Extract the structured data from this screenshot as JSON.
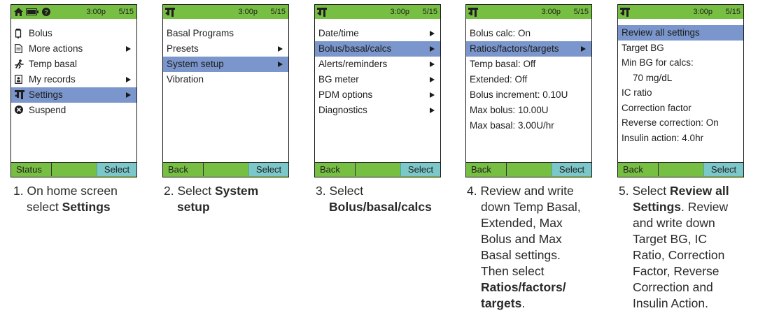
{
  "screens": [
    {
      "time": "3:00p",
      "date": "5/15",
      "items": [
        {
          "label": "Bolus",
          "icon": "bolus-icon",
          "sel": false,
          "arrow": false
        },
        {
          "label": "More actions",
          "icon": "document-icon",
          "sel": false,
          "arrow": true
        },
        {
          "label": "Temp basal",
          "icon": "runner-icon",
          "sel": false,
          "arrow": false
        },
        {
          "label": "My records",
          "icon": "records-icon",
          "sel": false,
          "arrow": true
        },
        {
          "label": "Settings",
          "icon": "settings-icon",
          "sel": true,
          "arrow": true
        },
        {
          "label": "Suspend",
          "icon": "suspend-icon",
          "sel": false,
          "arrow": false
        }
      ],
      "left": "Status",
      "right": "Select",
      "caption": [
        "1. On home screen",
        "select ",
        "Settings"
      ]
    },
    {
      "time": "3:00p",
      "date": "5/15",
      "items": [
        {
          "label": "Basal Programs",
          "sel": false,
          "arrow": false
        },
        {
          "label": "Presets",
          "sel": false,
          "arrow": true
        },
        {
          "label": "System setup",
          "sel": true,
          "arrow": true
        },
        {
          "label": "Vibration",
          "sel": false,
          "arrow": false
        }
      ],
      "left": "Back",
      "right": "Select",
      "caption": [
        "2. Select ",
        "System",
        "setup"
      ]
    },
    {
      "time": "3:00p",
      "date": "5/15",
      "items": [
        {
          "label": "Date/time",
          "sel": false,
          "arrow": true
        },
        {
          "label": "Bolus/basal/calcs",
          "sel": true,
          "arrow": true
        },
        {
          "label": "Alerts/reminders",
          "sel": false,
          "arrow": true
        },
        {
          "label": "BG meter",
          "sel": false,
          "arrow": true
        },
        {
          "label": "PDM options",
          "sel": false,
          "arrow": true
        },
        {
          "label": "Diagnostics",
          "sel": false,
          "arrow": true
        }
      ],
      "left": "Back",
      "right": "Select",
      "caption": [
        "3. Select",
        "Bolus/basal/calcs"
      ]
    },
    {
      "time": "3:00p",
      "date": "5/15",
      "items": [
        {
          "label": "Bolus calc: On",
          "sel": false,
          "arrow": false
        },
        {
          "label": "Ratios/factors/targets",
          "sel": true,
          "arrow": true
        },
        {
          "label": "Temp basal: Off",
          "sel": false,
          "arrow": false
        },
        {
          "label": "Extended: Off",
          "sel": false,
          "arrow": false
        },
        {
          "label": "Bolus increment: 0.10U",
          "sel": false,
          "arrow": false
        },
        {
          "label": "Max bolus: 10.00U",
          "sel": false,
          "arrow": false
        },
        {
          "label": "Max basal: 3.00U/hr",
          "sel": false,
          "arrow": false
        }
      ],
      "left": "Back",
      "right": "Select",
      "caption": [
        "4. Review and write",
        "down Temp Basal,",
        "Extended, Max",
        "Bolus and Max",
        "Basal settings.",
        "Then select",
        "Ratios/factors/",
        "targets",
        "."
      ]
    },
    {
      "time": "3:00p",
      "date": "5/15",
      "items": [
        {
          "label": "Review all settings",
          "sel": true,
          "arrow": false
        },
        {
          "label": "Target BG",
          "sel": false,
          "arrow": false
        },
        {
          "label": "Min BG for calcs:",
          "sel": false,
          "arrow": false
        },
        {
          "label": "70 mg/dL",
          "sel": false,
          "arrow": false,
          "indent": true
        },
        {
          "label": "IC ratio",
          "sel": false,
          "arrow": false
        },
        {
          "label": "Correction factor",
          "sel": false,
          "arrow": false
        },
        {
          "label": "Reverse correction: On",
          "sel": false,
          "arrow": false
        },
        {
          "label": "Insulin action: 4.0hr",
          "sel": false,
          "arrow": false
        }
      ],
      "left": "Back",
      "right": "Select",
      "caption": [
        "5. Select ",
        "Review all",
        "Settings",
        ". Review",
        "and write down",
        "Target BG, IC",
        "Ratio, Correction",
        "Factor, Reverse",
        "Correction and",
        "Insulin Action."
      ]
    }
  ],
  "home_topbar_icons": [
    "home-icon",
    "battery-icon",
    "alert-icon"
  ],
  "sub_topbar_icons": [
    "settings-icon"
  ],
  "colors": {
    "bar_green": "#77bf43",
    "highlight": "#7a96cc",
    "select_cyan": "#7cc7c9"
  }
}
